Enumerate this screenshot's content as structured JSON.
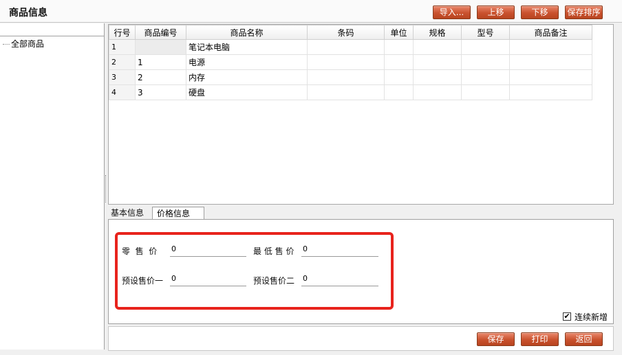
{
  "header": {
    "title": "商品信息",
    "buttons": {
      "import": "导入...",
      "move_up": "上移",
      "move_down": "下移",
      "save_order": "保存排序"
    }
  },
  "tree": {
    "root_label": "全部商品"
  },
  "grid": {
    "columns": [
      "行号",
      "商品编号",
      "商品名称",
      "条码",
      "单位",
      "规格",
      "型号",
      "商品备注"
    ],
    "rows": [
      {
        "row_no": "1",
        "code": "",
        "name": "笔记本电脑"
      },
      {
        "row_no": "2",
        "code": "1",
        "name": "电源"
      },
      {
        "row_no": "3",
        "code": "2",
        "name": "内存"
      },
      {
        "row_no": "4",
        "code": "3",
        "name": "硬盘"
      }
    ]
  },
  "tabs": {
    "basic": "基本信息",
    "price": "价格信息"
  },
  "price_form": {
    "retail_label": "零  售  价",
    "retail_value": "0",
    "min_label": "最 低 售 价",
    "min_value": "0",
    "preset1_label": "预设售价一",
    "preset1_value": "0",
    "preset2_label": "预设售价二",
    "preset2_value": "0"
  },
  "options": {
    "continuous_add": "连续新增",
    "continuous_add_checked": true,
    "check_mark": "✔"
  },
  "footer": {
    "save": "保存",
    "print": "打印",
    "back": "返回"
  },
  "colors": {
    "button": "#c9522e",
    "highlight": "#e8231c"
  }
}
